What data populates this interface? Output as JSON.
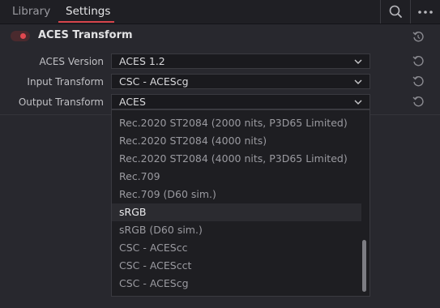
{
  "tabs": {
    "library": "Library",
    "settings": "Settings"
  },
  "toolbar": {
    "search_icon": "search-icon",
    "more_icon": "more-icon"
  },
  "section": {
    "title": "ACES Transform",
    "enabled": true
  },
  "colors": {
    "accent": "#d6444b",
    "toggle_on": "#e24850",
    "background": "#28282e",
    "selected_row": "#2b2b30"
  },
  "rows": [
    {
      "label": "ACES Version",
      "value": "ACES 1.2"
    },
    {
      "label": "Input Transform",
      "value": "CSC - ACEScg"
    },
    {
      "label": "Output Transform",
      "value": "ACES"
    }
  ],
  "menu": {
    "selected": "sRGB",
    "items": [
      "Rec.2020 ST2084 (2000 nits, P3D65 Limited)",
      "Rec.2020 ST2084 (4000 nits)",
      "Rec.2020 ST2084 (4000 nits, P3D65 Limited)",
      "Rec.709",
      "Rec.709 (D60 sim.)",
      "sRGB",
      "sRGB (D60 sim.)",
      "CSC - ACEScc",
      "CSC - ACEScct",
      "CSC - ACEScg"
    ]
  }
}
